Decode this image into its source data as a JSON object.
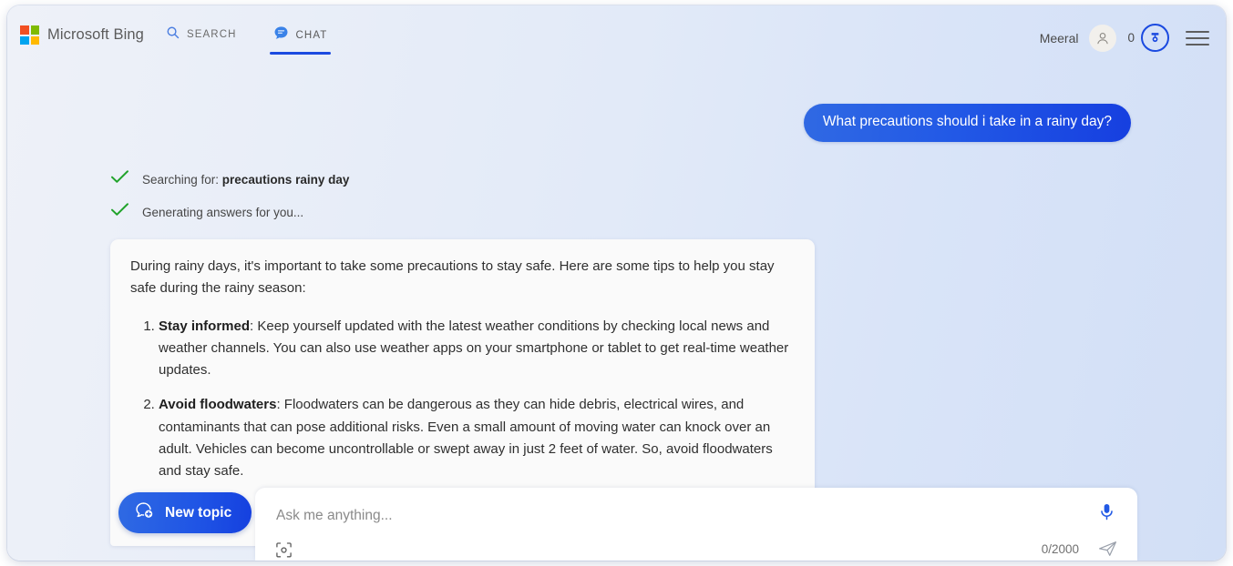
{
  "header": {
    "brand_name": "Microsoft Bing",
    "logo_icon": "microsoft-squares-icon",
    "tabs": [
      {
        "label": "SEARCH",
        "icon": "search-icon",
        "active": false
      },
      {
        "label": "CHAT",
        "icon": "chat-bubble-icon",
        "active": true
      }
    ],
    "user_name": "Meeral",
    "avatar_icon": "person-icon",
    "rewards_count": "0",
    "rewards_icon": "rewards-medal-icon",
    "menu_icon": "hamburger-menu-icon"
  },
  "conversation": {
    "user_message": "What precautions should i take in a rainy day?",
    "status": [
      {
        "icon": "check-icon",
        "prefix": "Searching for: ",
        "query": "precautions rainy day"
      },
      {
        "icon": "check-icon",
        "prefix": "Generating answers for you...",
        "query": ""
      }
    ],
    "answer": {
      "intro": "During rainy days, it's important to take some precautions to stay safe. Here are some tips to help you stay safe during the rainy season:",
      "items": [
        {
          "title": "Stay informed",
          "body": ": Keep yourself updated with the latest weather conditions by checking local news and weather channels. You can also use weather apps on your smartphone or tablet to get real-time weather updates."
        },
        {
          "title": "Avoid floodwaters",
          "body": ": Floodwaters can be dangerous as they can hide debris, electrical wires, and contaminants that can pose additional risks. Even a small amount of moving water can knock over an adult. Vehicles can become uncontrollable or swept away in just 2 feet of water. So, avoid floodwaters and stay safe."
        }
      ]
    }
  },
  "composer": {
    "new_topic_label": "New topic",
    "new_topic_icon": "chat-plus-icon",
    "placeholder": "Ask me anything...",
    "visual_search_icon": "camera-visual-search-icon",
    "mic_icon": "microphone-icon",
    "counter": "0/2000",
    "send_icon": "send-paper-plane-icon"
  },
  "colors": {
    "accent_blue": "#1b4ae0",
    "bubble_blue": "#2259e6",
    "check_green": "#21a32b",
    "page_bg_left": "#eef1f8",
    "page_bg_right": "#d2dff6"
  }
}
